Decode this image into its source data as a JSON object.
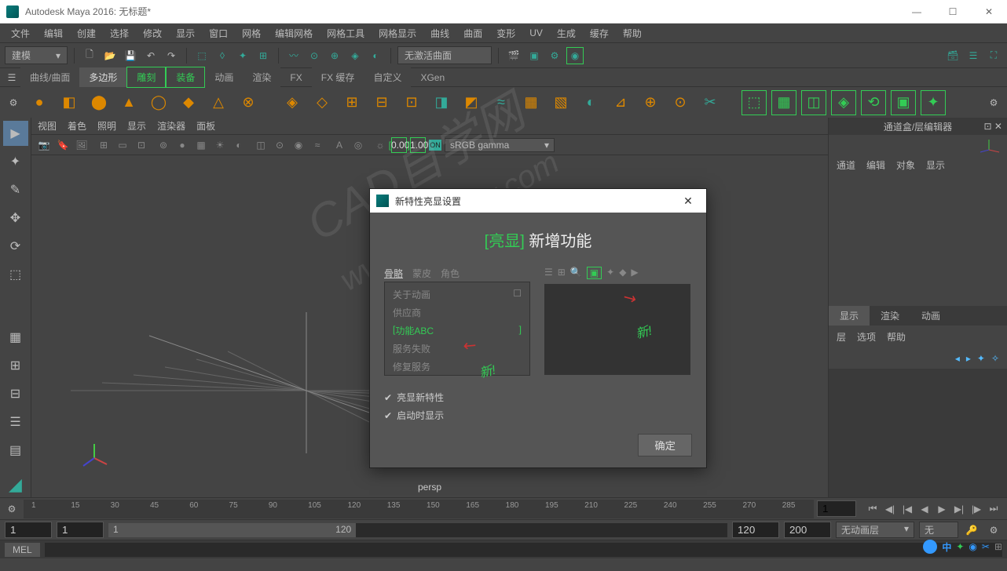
{
  "window": {
    "title": "Autodesk Maya 2016: 无标题*",
    "minimize": "—",
    "maximize": "☐",
    "close": "✕"
  },
  "menu": [
    "文件",
    "编辑",
    "创建",
    "选择",
    "修改",
    "显示",
    "窗口",
    "网格",
    "编辑网格",
    "网格工具",
    "网格显示",
    "曲线",
    "曲面",
    "变形",
    "UV",
    "生成",
    "缓存",
    "帮助"
  ],
  "workspace": {
    "label": "建模"
  },
  "surface_dropdown": "无激活曲面",
  "shelf_tabs": [
    "曲线/曲面",
    "多边形",
    "雕刻",
    "装备",
    "动画",
    "渲染",
    "FX",
    "FX 缓存",
    "自定义",
    "XGen"
  ],
  "viewport_menu": [
    "视图",
    "着色",
    "照明",
    "显示",
    "渲染器",
    "面板"
  ],
  "viewport": {
    "num1": "0.00",
    "num2": "1.00",
    "gamma": "sRGB gamma",
    "label": "persp"
  },
  "channel_box": {
    "title": "通道盒/层编辑器",
    "tabs": [
      "通道",
      "编辑",
      "对象",
      "显示"
    ],
    "bottom_tabs": [
      "显示",
      "渲染",
      "动画"
    ],
    "menu2": [
      "层",
      "选项",
      "帮助"
    ]
  },
  "timeline": {
    "ticks": [
      "1",
      "15",
      "30",
      "45",
      "60",
      "75",
      "90",
      "105",
      "120",
      "135",
      "150",
      "165",
      "180",
      "195",
      "210",
      "225",
      "240",
      "255",
      "270",
      "285"
    ],
    "frame": "1",
    "range_start": "1",
    "range_vis_start": "1",
    "range_slider_start": "1",
    "range_slider_end": "120",
    "range_vis_end": "120",
    "range_end": "200",
    "layer": "无动画层",
    "nochar": "无"
  },
  "cmd": {
    "mel": "MEL"
  },
  "dialog": {
    "title": "新特性亮显设置",
    "heading_hl": "[亮显]",
    "heading_rest": "新增功能",
    "tabs": [
      "骨骼",
      "蒙皮",
      "角色"
    ],
    "items": [
      "关于动画",
      "供应商",
      "功能ABC",
      "服务失败",
      "修复服务"
    ],
    "new_label": "新!",
    "chk1": "亮显新特性",
    "chk2": "启动时显示",
    "ok": "确定"
  },
  "watermark": "CAD自学网\nwww.cadzxw.com"
}
